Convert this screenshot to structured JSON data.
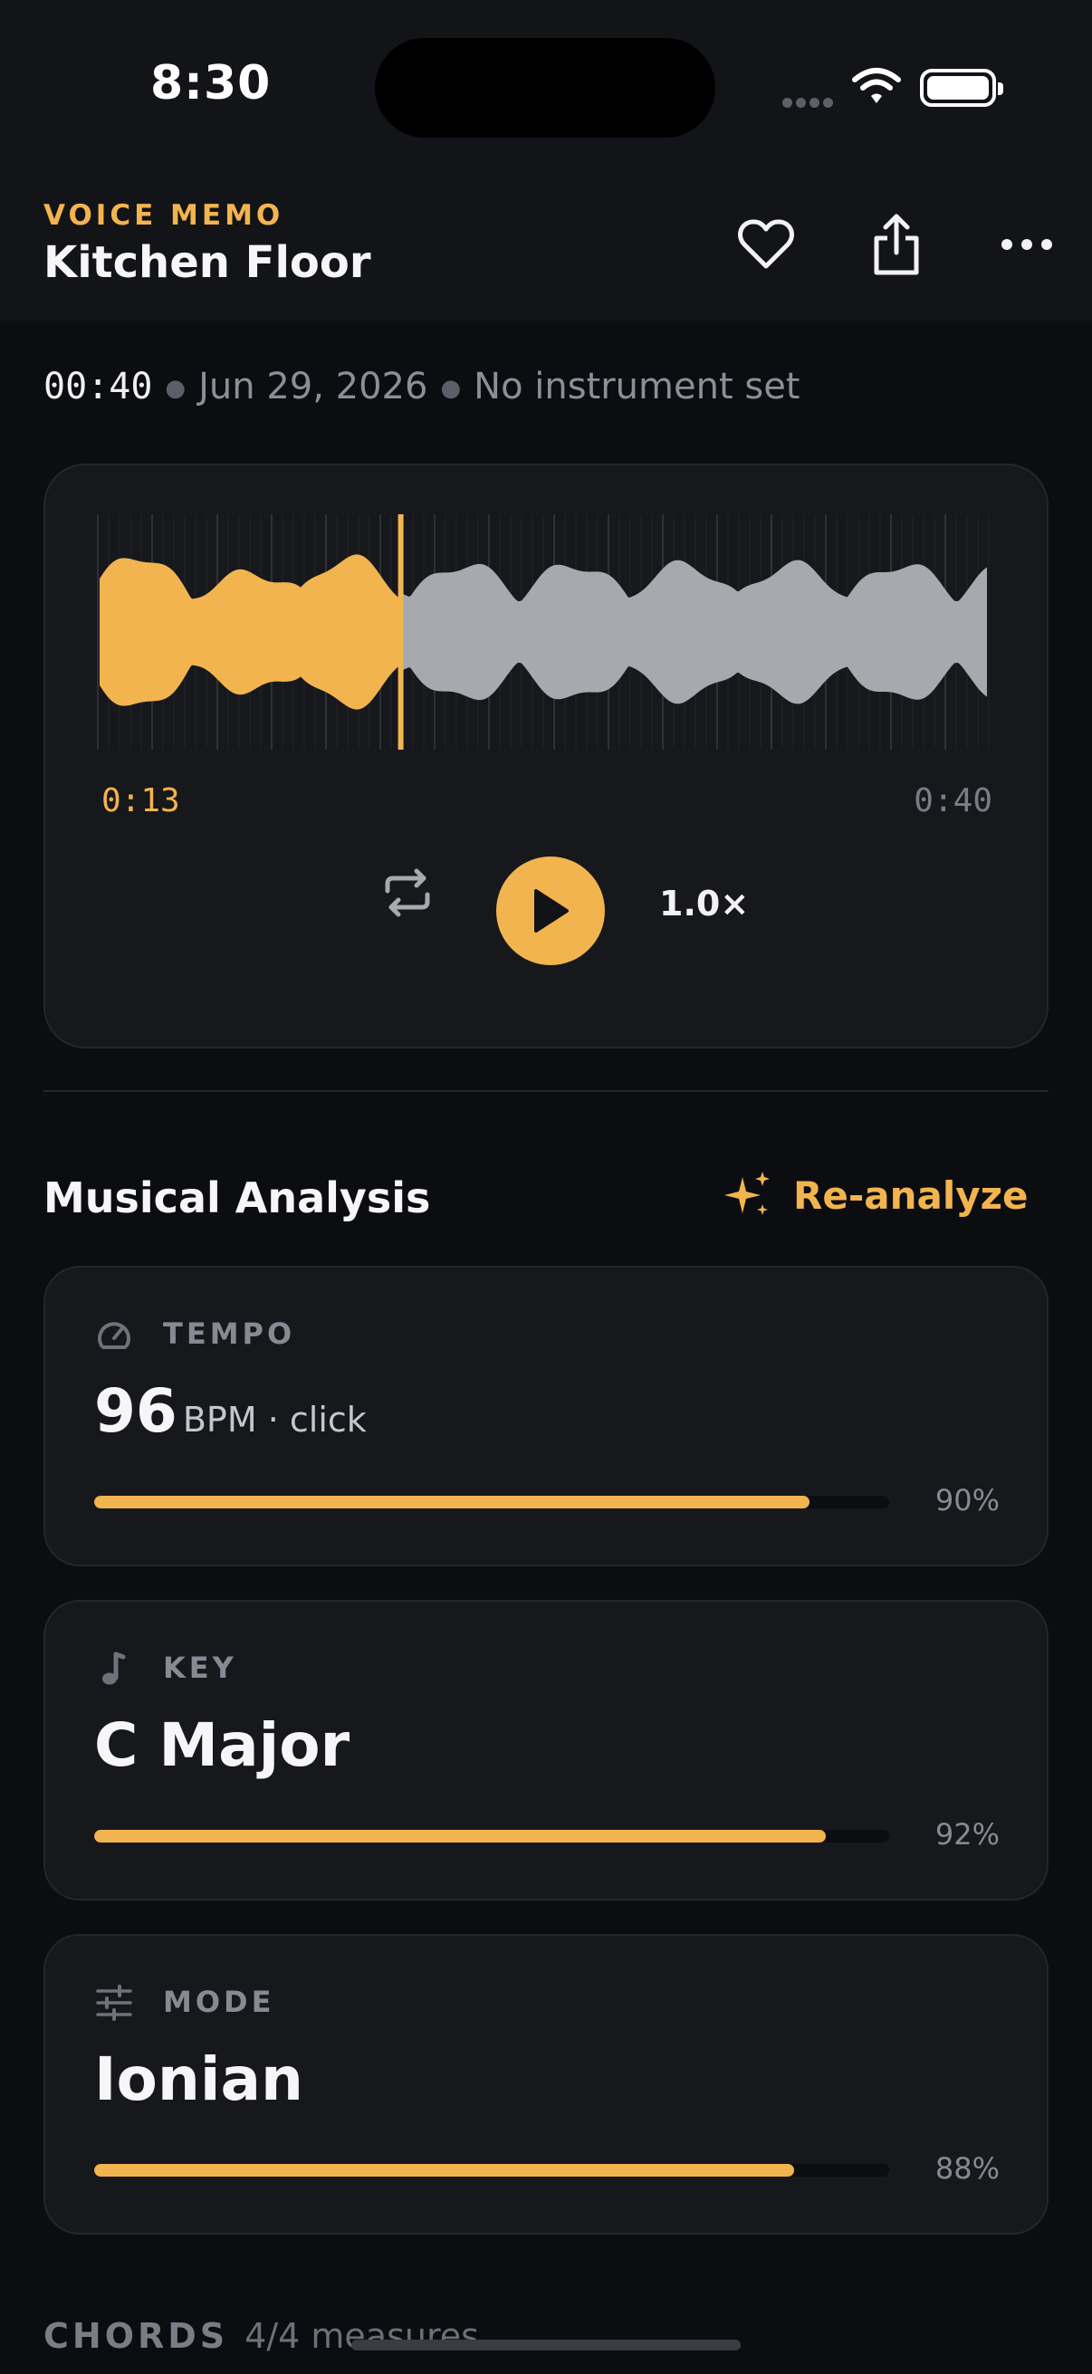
{
  "status": {
    "time": "8:30"
  },
  "header": {
    "eyebrow": "VOICE MEMO",
    "title": "Kitchen Floor",
    "favorite_icon": "heart-icon",
    "share_icon": "share-icon",
    "more_icon": "more-horizontal-icon"
  },
  "meta": {
    "duration": "00:40",
    "date": "Jun 29, 2026",
    "instrument": "No instrument set"
  },
  "player": {
    "current_time": "0:13",
    "total_time": "0:40",
    "progress": 0.34,
    "speed": "1.0×",
    "loop_icon": "repeat-icon",
    "play_icon": "play-icon"
  },
  "analysis": {
    "title": "Musical Analysis",
    "reanalyze_label": "Re-analyze",
    "reanalyze_icon": "sparkles-icon",
    "cards": [
      {
        "label": "TEMPO",
        "value": "96",
        "unit": "BPM · click",
        "confidence": 0.9,
        "confidence_label": "90%",
        "icon": "gauge-icon"
      },
      {
        "label": "KEY",
        "value": "C Major",
        "unit": "",
        "confidence": 0.92,
        "confidence_label": "92%",
        "icon": "music-note-icon"
      },
      {
        "label": "MODE",
        "value": "Ionian",
        "unit": "",
        "confidence": 0.88,
        "confidence_label": "88%",
        "icon": "sliders-icon"
      }
    ]
  },
  "chords": {
    "label": "CHORDS",
    "subtitle": "4/4 measures"
  },
  "colors": {
    "accent": "#f2b44e",
    "background": "#0c0d10",
    "card": "#17181c",
    "wave_inactive": "#a6a9ae"
  }
}
